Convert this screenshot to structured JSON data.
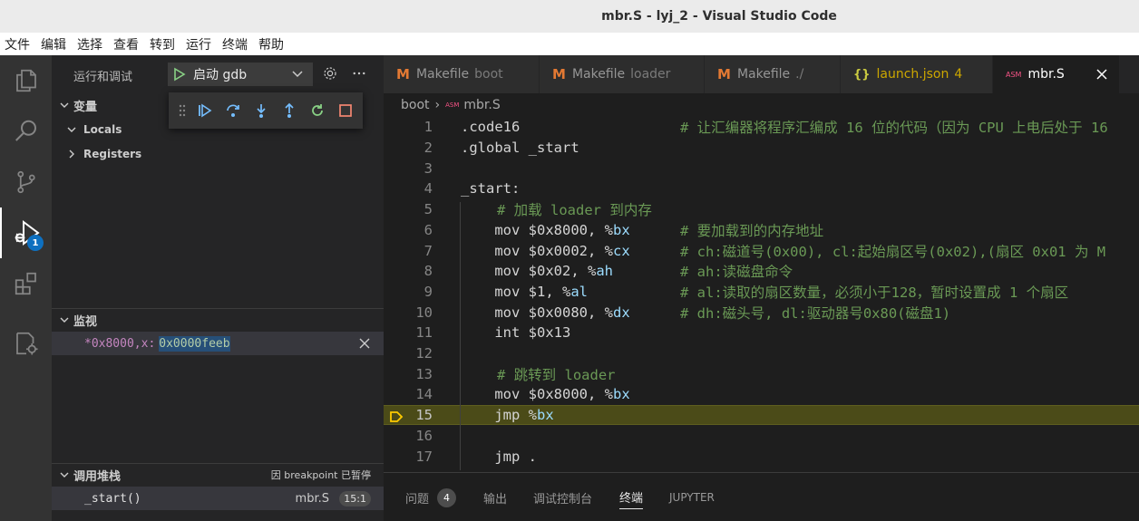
{
  "window": {
    "title": "mbr.S - lyj_2 - Visual Studio Code"
  },
  "menu": [
    "文件",
    "编辑",
    "选择",
    "查看",
    "转到",
    "运行",
    "终端",
    "帮助"
  ],
  "activity": {
    "debug_badge": "1"
  },
  "sidebar": {
    "title": "运行和调试",
    "launch_config": "启动 gdb",
    "variables": {
      "title": "变量",
      "locals": "Locals",
      "registers": "Registers"
    },
    "watch": {
      "title": "监视",
      "expression": "*0x8000,x:",
      "value": "0x0000feeb"
    },
    "callstack": {
      "title": "调用堆栈",
      "paused": "因 breakpoint 已暂停",
      "frame": "_start()",
      "file": "mbr.S",
      "position": "15:1"
    }
  },
  "tabs": [
    {
      "icon": "M",
      "name": "Makefile",
      "desc": "boot"
    },
    {
      "icon": "M",
      "name": "Makefile",
      "desc": "loader"
    },
    {
      "icon": "M",
      "name": "Makefile",
      "desc": "./"
    },
    {
      "icon": "{}",
      "name": "launch.json",
      "count": "4"
    },
    {
      "icon": "ASM",
      "name": "mbr.S"
    }
  ],
  "breadcrumb": {
    "folder": "boot",
    "icon": "ASM",
    "file": "mbr.S"
  },
  "code": [
    {
      "n": "1",
      "code": ".code16",
      "comment": "# 让汇编器将程序汇编成 16 位的代码（因为 CPU 上电后处于 16"
    },
    {
      "n": "2",
      "code": ".global _start",
      "comment": ""
    },
    {
      "n": "3",
      "code": "",
      "comment": ""
    },
    {
      "n": "4",
      "code": "_start:",
      "comment": ""
    },
    {
      "n": "5",
      "code": "    ",
      "comment": "# 加载 loader 到内存"
    },
    {
      "n": "6",
      "code": "    mov $0x8000, %",
      "reg": "bx",
      "pad": "    ",
      "comment": "# 要加载到的内存地址"
    },
    {
      "n": "7",
      "code": "    mov $0x0002, %",
      "reg": "cx",
      "pad": "    ",
      "comment": "# ch:磁道号(0x00), cl:起始扇区号(0x02),(扇区 0x01 为 M"
    },
    {
      "n": "8",
      "code": "    mov $0x02, %",
      "reg": "ah",
      "pad": "      ",
      "comment": "# ah:读磁盘命令"
    },
    {
      "n": "9",
      "code": "    mov $1, %",
      "reg": "al",
      "pad": "         ",
      "comment": "# al:读取的扇区数量，必须小于128，暂时设置成 1 个扇区"
    },
    {
      "n": "10",
      "code": "    mov $0x0080, %",
      "reg": "dx",
      "pad": "    ",
      "comment": "# dh:磁头号, dl:驱动器号0x80(磁盘1)"
    },
    {
      "n": "11",
      "code": "    int $0x13",
      "comment": ""
    },
    {
      "n": "12",
      "code": "",
      "comment": ""
    },
    {
      "n": "13",
      "code": "    ",
      "comment": "# 跳转到 loader"
    },
    {
      "n": "14",
      "code": "    mov $0x8000, %",
      "reg": "bx",
      "comment": ""
    },
    {
      "n": "15",
      "code": "    jmp %",
      "reg": "bx",
      "comment": "",
      "current": true
    },
    {
      "n": "16",
      "code": "",
      "comment": ""
    },
    {
      "n": "17",
      "code": "    jmp .",
      "comment": ""
    }
  ],
  "panel": {
    "tabs": [
      "问题",
      "输出",
      "调试控制台",
      "终端",
      "JUPYTER"
    ],
    "problems_count": "4",
    "active": "终端"
  },
  "colors": {
    "accent": "#0e70c0",
    "current_line": "#4b4b18",
    "comment": "#6a9955",
    "register": "#9cdcfe"
  }
}
